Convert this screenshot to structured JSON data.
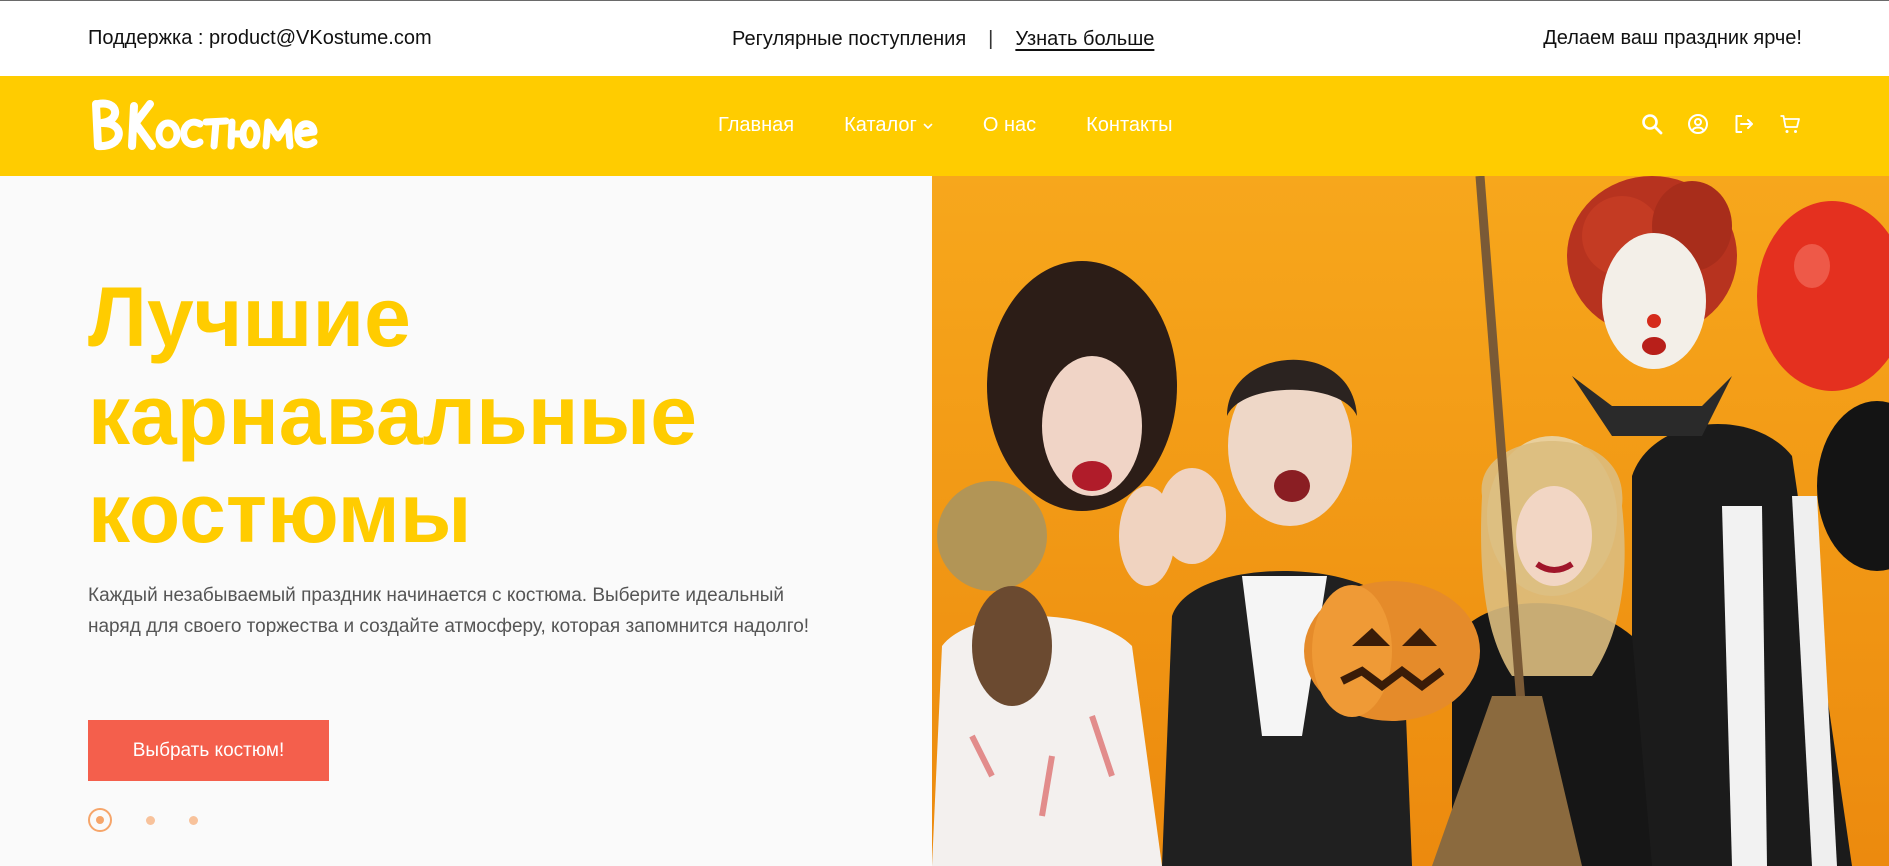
{
  "topbar": {
    "support": "Поддержка : product@VKostume.com",
    "arrivals": "Регулярные поступления",
    "separator": "|",
    "learn_more": "Узнать больше",
    "slogan": "Делаем ваш праздник ярче!"
  },
  "header": {
    "logo_text": "ВКостюме",
    "nav": [
      {
        "label": "Главная"
      },
      {
        "label": "Каталог"
      },
      {
        "label": "О нас"
      },
      {
        "label": "Контакты"
      }
    ],
    "icons": [
      "search-icon",
      "user-icon",
      "logout-icon",
      "cart-icon"
    ]
  },
  "hero": {
    "title_line1": "Лучшие",
    "title_line2": "карнавальные",
    "title_line3": "костюмы",
    "description": "Каждый незабываемый праздник начинается с костюма. Выберите идеальный наряд для своего торжества и создайте атмосферу, которая запомнится надолго!",
    "cta_label": "Выбрать костюм!",
    "slides_total": 3,
    "active_slide": 1
  },
  "colors": {
    "brand_yellow": "#ffcc00",
    "cta_red": "#f45f4c",
    "dot_orange": "#f6a56a"
  }
}
